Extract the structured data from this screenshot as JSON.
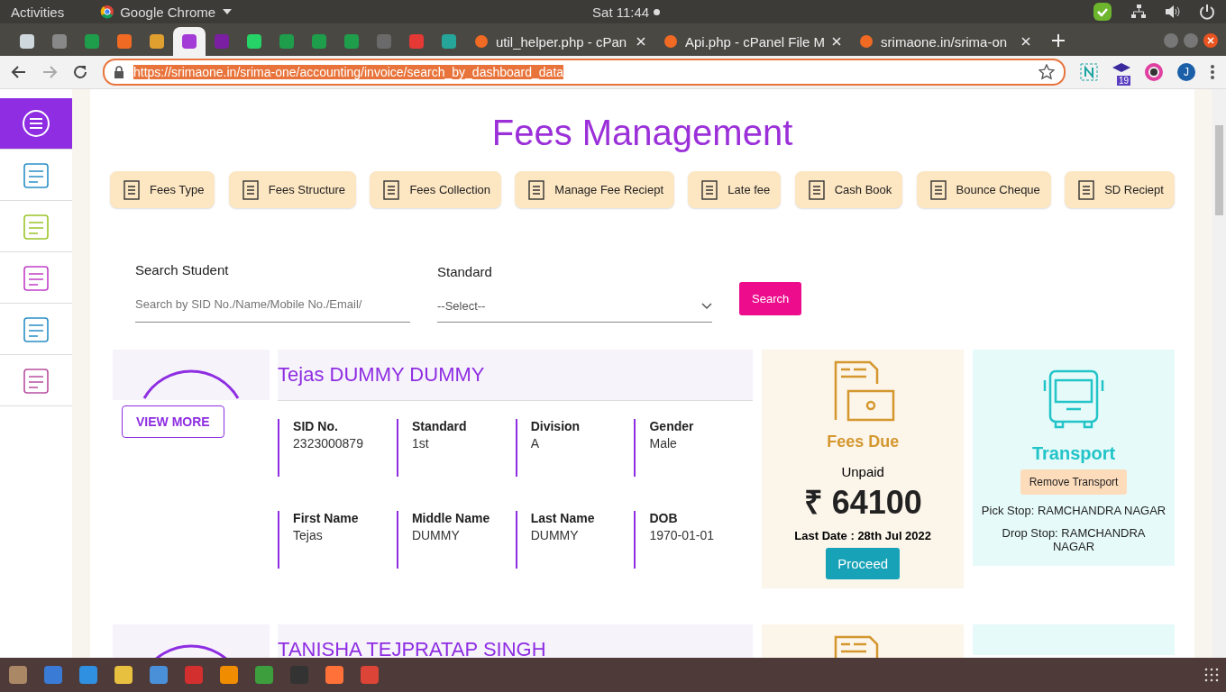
{
  "topbar": {
    "activities": "Activities",
    "app": "Google Chrome",
    "clock": "Sat 11:44"
  },
  "tabs": [
    {
      "kind": "icon",
      "selected": false
    },
    {
      "kind": "icon",
      "selected": false
    },
    {
      "kind": "icon",
      "selected": false
    },
    {
      "kind": "icon",
      "selected": false
    },
    {
      "kind": "icon",
      "selected": false
    },
    {
      "kind": "icon",
      "selected": true
    },
    {
      "kind": "icon",
      "selected": false
    },
    {
      "kind": "icon",
      "selected": false
    },
    {
      "kind": "icon",
      "selected": false
    },
    {
      "kind": "icon",
      "selected": false
    },
    {
      "kind": "icon",
      "selected": false
    },
    {
      "kind": "icon",
      "selected": false
    },
    {
      "kind": "icon",
      "selected": false
    },
    {
      "kind": "icon",
      "selected": false
    },
    {
      "kind": "titled",
      "title": "util_helper.php - cPan",
      "selected": false
    },
    {
      "kind": "titled",
      "title": "Api.php - cPanel File M",
      "selected": false
    },
    {
      "kind": "titled",
      "title": "srimaone.in/srima-on",
      "selected": false
    }
  ],
  "address_bar": {
    "url": "https://srimaone.in/srima-one/accounting/invoice/search_by_dashboard_data",
    "extension_badge": "19",
    "profile": "J"
  },
  "sidebar": {
    "items": [
      {
        "selected": true
      },
      {
        "selected": false
      },
      {
        "selected": false
      },
      {
        "selected": false
      },
      {
        "selected": false
      },
      {
        "selected": false
      }
    ]
  },
  "page": {
    "title": "Fees Management",
    "nav": [
      "Fees Type",
      "Fees Structure",
      "Fees Collection",
      "Manage Fee Reciept",
      "Late fee",
      "Cash Book",
      "Bounce Cheque",
      "SD Reciept"
    ],
    "search": {
      "label": "Search Student",
      "placeholder": "Search by SID No./Name/Mobile No./Email/",
      "standard_label": "Standard",
      "standard_value": "--Select--",
      "button": "Search"
    },
    "students": [
      {
        "name": "Tejas DUMMY DUMMY",
        "view_more": "VIEW MORE",
        "fields": [
          {
            "label": "SID No.",
            "value": "2323000879"
          },
          {
            "label": "Standard",
            "value": "1st"
          },
          {
            "label": "Division",
            "value": "A"
          },
          {
            "label": "Gender",
            "value": "Male"
          },
          {
            "label": "First Name",
            "value": "Tejas"
          },
          {
            "label": "Middle Name",
            "value": "DUMMY"
          },
          {
            "label": "Last Name",
            "value": "DUMMY"
          },
          {
            "label": "DOB",
            "value": "1970-01-01"
          }
        ],
        "fees": {
          "title": "Fees Due",
          "status": "Unpaid",
          "amount": "₹ 64100",
          "last_date": "Last Date : 28th Jul 2022",
          "button": "Proceed"
        },
        "transport": {
          "title": "Transport",
          "button": "Remove Transport",
          "pick": "Pick Stop: RAMCHANDRA NAGAR",
          "drop": "Drop Stop: RAMCHANDRA NAGAR"
        }
      },
      {
        "name": "TANISHA TEJPRATAP SINGH"
      }
    ]
  }
}
